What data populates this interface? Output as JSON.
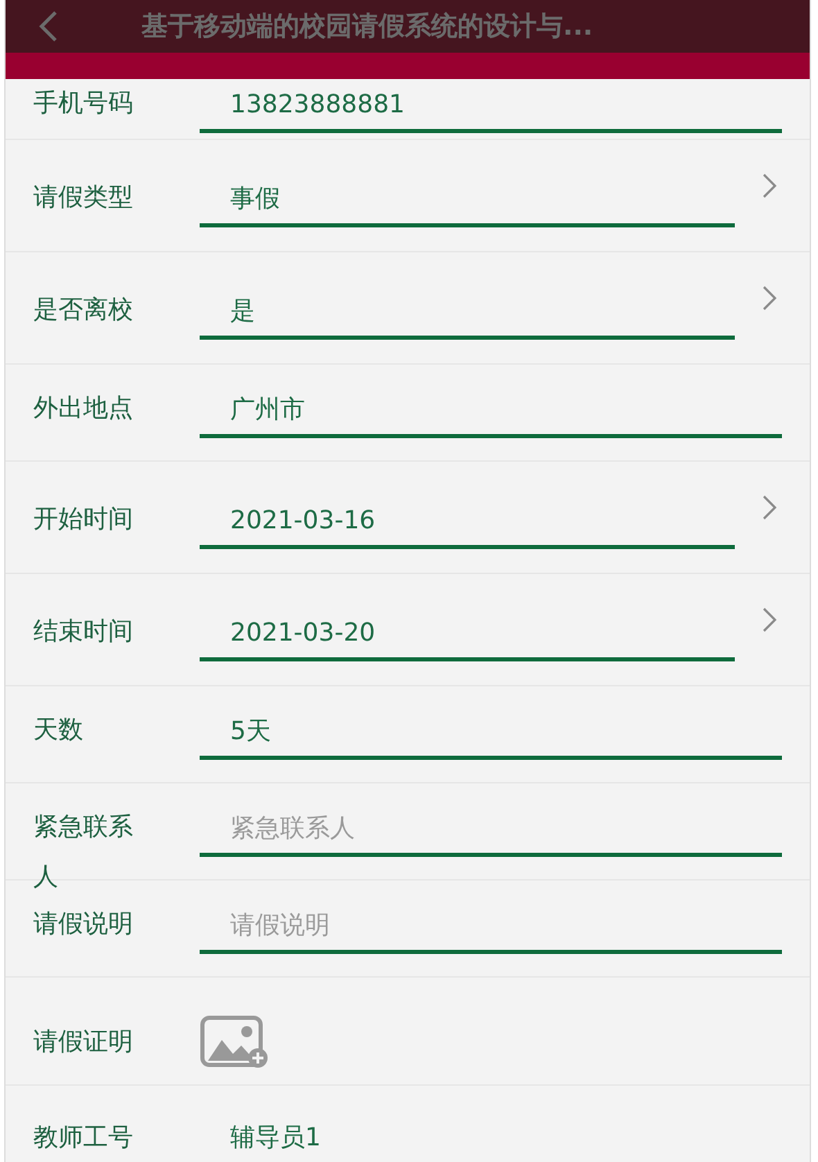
{
  "header": {
    "title": "基于移动端的校园请假系统的设计与..."
  },
  "rows": [
    {
      "kind": "text",
      "label": "手机号码",
      "value": "13823888881"
    },
    {
      "kind": "select",
      "label": "请假类型",
      "value": "事假"
    },
    {
      "kind": "select",
      "label": "是否离校",
      "value": "是"
    },
    {
      "kind": "text",
      "label": "外出地点",
      "value": "广州市"
    },
    {
      "kind": "select",
      "label": "开始时间",
      "value": "2021-03-16"
    },
    {
      "kind": "select",
      "label": "结束时间",
      "value": "2021-03-20"
    },
    {
      "kind": "text",
      "label": "天数",
      "value": "5天"
    },
    {
      "kind": "text",
      "label": "紧急联系人",
      "placeholder": "紧急联系人"
    },
    {
      "kind": "text",
      "label": "请假说明",
      "placeholder": "请假说明"
    },
    {
      "kind": "image",
      "label": "请假证明"
    },
    {
      "kind": "plain",
      "label": "教师工号",
      "value": "辅导员1"
    }
  ]
}
